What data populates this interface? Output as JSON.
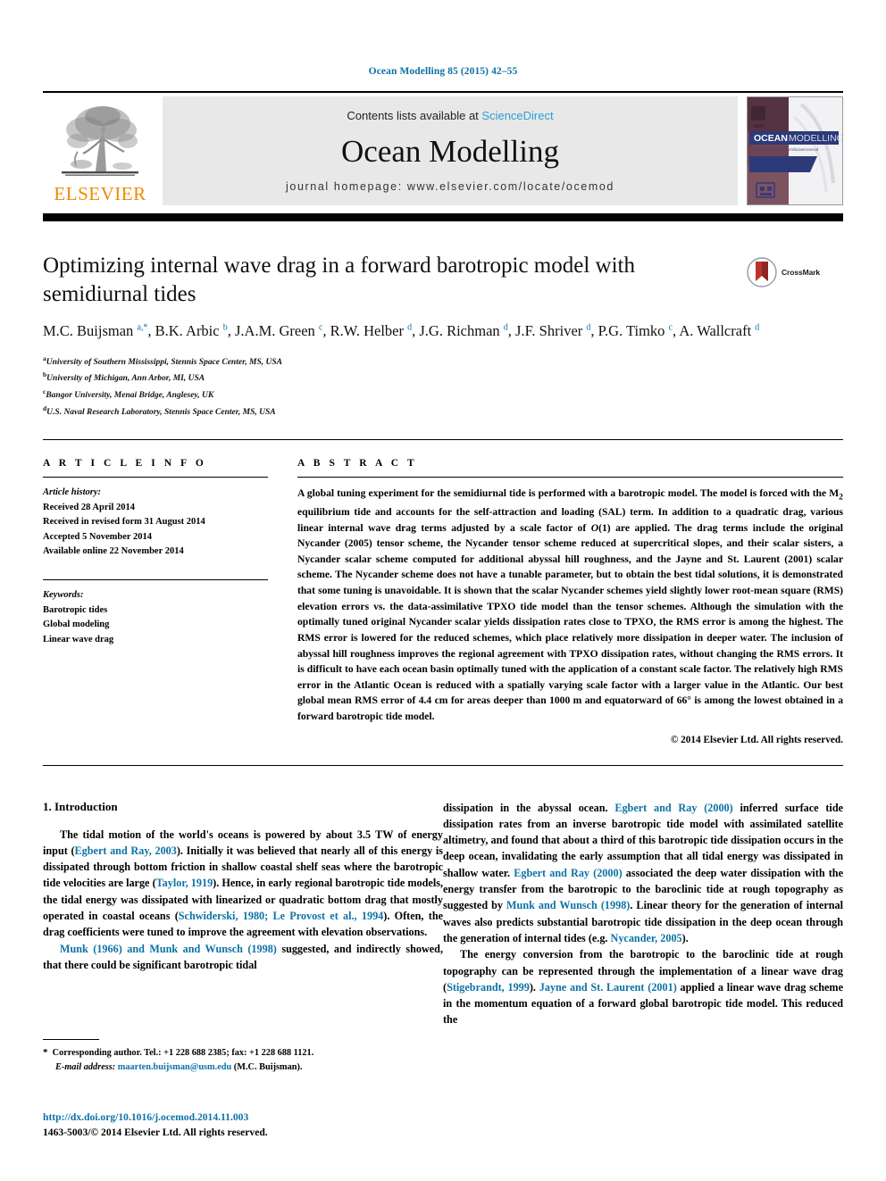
{
  "running_head": "Ocean Modelling 85 (2015) 42–55",
  "masthead": {
    "publisher_name": "ELSEVIER",
    "contents_prefix": "Contents lists available at ",
    "sciencedirect": "ScienceDirect",
    "journal_title": "Ocean Modelling",
    "homepage": "journal homepage: www.elsevier.com/locate/ocemod",
    "cover_title_bold": "OCEAN",
    "cover_title_light": "MODELLING",
    "cover_subtitle": "http://www.elsevier.com/locate/ocemod"
  },
  "article": {
    "title": "Optimizing internal wave drag in a forward barotropic model with semidiurnal tides",
    "crossmark_label": "CrossMark",
    "authors_html": "M.C. Buijsman <sup>a,*</sup>, B.K. Arbic <sup>b</sup>, J.A.M. Green <sup>c</sup>, R.W. Helber <sup>d</sup>, J.G. Richman <sup>d</sup>, J.F. Shriver <sup>d</sup>, P.G. Timko <sup>c</sup>, A. Wallcraft <sup>d</sup>",
    "affiliations": [
      {
        "mark": "a",
        "text": "University of Southern Mississippi, Stennis Space Center, MS, USA"
      },
      {
        "mark": "b",
        "text": "University of Michigan, Ann Arbor, MI, USA"
      },
      {
        "mark": "c",
        "text": "Bangor University, Menai Bridge, Anglesey, UK"
      },
      {
        "mark": "d",
        "text": "U.S. Naval Research Laboratory, Stennis Space Center, MS, USA"
      }
    ]
  },
  "article_info": {
    "heading": "A R T I C L E   I N F O",
    "history_label": "Article history:",
    "history": [
      "Received 28 April 2014",
      "Received in revised form 31 August 2014",
      "Accepted 5 November 2014",
      "Available online 22 November 2014"
    ],
    "keywords_label": "Keywords:",
    "keywords": [
      "Barotropic tides",
      "Global modeling",
      "Linear wave drag"
    ]
  },
  "abstract": {
    "heading": "A B S T R A C T",
    "text_html": "A global tuning experiment for the semidiurnal tide is performed with a barotropic model. The model is forced with the M<sub>2</sub> equilibrium tide and accounts for the self-attraction and loading (SAL) term. In addition to a quadratic drag, various linear internal wave drag terms adjusted by a scale factor of <span class=\"cal\">O</span>(1) are applied. The drag terms include the original Nycander (2005) tensor scheme, the Nycander tensor scheme reduced at supercritical slopes, and their scalar sisters, a Nycander scalar scheme computed for additional abyssal hill roughness, and the Jayne and St. Laurent (2001) scalar scheme. The Nycander scheme does not have a tunable parameter, but to obtain the best tidal solutions, it is demonstrated that some tuning is unavoidable. It is shown that the scalar Nycander schemes yield slightly lower root-mean square (RMS) elevation errors vs. the data-assimilative TPXO tide model than the tensor schemes. Although the simulation with the optimally tuned original Nycander scalar yields dissipation rates close to TPXO, the RMS error is among the highest. The RMS error is lowered for the reduced schemes, which place relatively more dissipation in deeper water. The inclusion of abyssal hill roughness improves the regional agreement with TPXO dissipation rates, without changing the RMS errors. It is difficult to have each ocean basin optimally tuned with the application of a constant scale factor. The relatively high RMS error in the Atlantic Ocean is reduced with a spatially varying scale factor with a larger value in the Atlantic. Our best global mean RMS error of 4.4 cm for areas deeper than 1000 m and equatorward of 66° is among the lowest obtained in a forward barotropic tide model.",
    "copyright": "© 2014 Elsevier Ltd. All rights reserved."
  },
  "body": {
    "section_title": "1. Introduction",
    "left_paragraphs_html": [
      "The tidal motion of the world's oceans is powered by about 3.5 TW of energy input (<span class=\"ref\">Egbert and Ray, 2003</span>). Initially it was believed that nearly all of this energy is dissipated through bottom friction in shallow coastal shelf seas where the barotropic tide velocities are large (<span class=\"ref\">Taylor, 1919</span>). Hence, in early regional barotropic tide models, the tidal energy was dissipated with linearized or quadratic bottom drag that mostly operated in coastal oceans (<span class=\"ref\">Schwiderski, 1980; Le Provost et al., 1994</span>). Often, the drag coefficients were tuned to improve the agreement with elevation observations.",
      "<span class=\"ref\">Munk (1966) and Munk and Wunsch (1998)</span> suggested, and indirectly showed, that there could be significant barotropic tidal"
    ],
    "right_paragraphs_html": [
      "dissipation in the abyssal ocean. <span class=\"ref\">Egbert and Ray (2000)</span> inferred surface tide dissipation rates from an inverse barotropic tide model with assimilated satellite altimetry, and found that about a third of this barotropic tide dissipation occurs in the deep ocean, invalidating the early assumption that all tidal energy was dissipated in shallow water. <span class=\"ref\">Egbert and Ray (2000)</span> associated the deep water dissipation with the energy transfer from the barotropic to the baroclinic tide at rough topography as suggested by <span class=\"ref\">Munk and Wunsch (1998)</span>. Linear theory for the generation of internal waves also predicts substantial barotropic tide dissipation in the deep ocean through the generation of internal tides (e.g. <span class=\"ref\">Nycander, 2005</span>).",
      "The energy conversion from the barotropic to the baroclinic tide at rough topography can be represented through the implementation of a linear wave drag (<span class=\"ref\">Stigebrandt, 1999</span>). <span class=\"ref\">Jayne and St. Laurent (2001)</span> applied a linear wave drag scheme in the momentum equation of a forward global barotropic tide model. This reduced the"
    ]
  },
  "footnotes": {
    "corresponding_html": "<span class=\"star\">*</span>&nbsp; Corresponding author. Tel.: +1 228 688 2385; fax: +1 228 688 1121.",
    "email_html": "<span class=\"ital\">E-mail address:</span> <span class=\"mail\">maarten.buijsman@usm.edu</span> (M.C. Buijsman)."
  },
  "doi": {
    "url": "http://dx.doi.org/10.1016/j.ocemod.2014.11.003",
    "issn_line": "1463-5003/© 2014 Elsevier Ltd. All rights reserved."
  },
  "colors": {
    "link_blue": "#0d72a5",
    "sciencedirect_blue": "#2a9fd6",
    "elsevier_orange": "#f08a00",
    "masthead_gray": "#e8e8e8"
  }
}
